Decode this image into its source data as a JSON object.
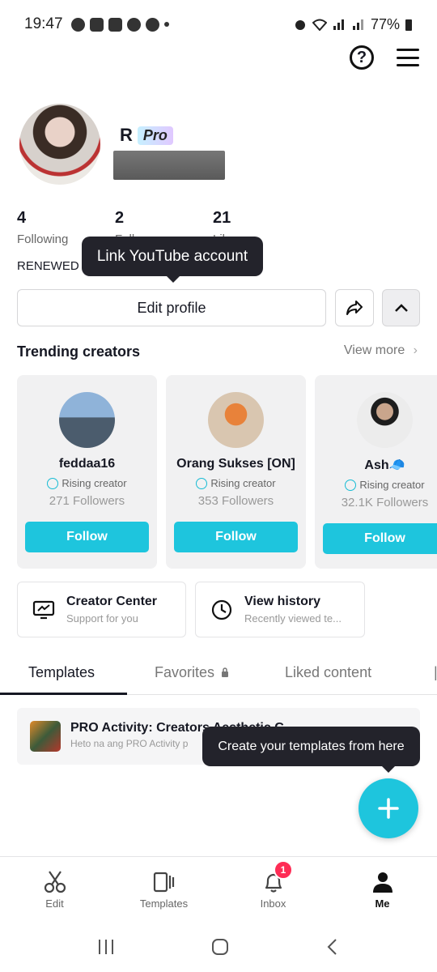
{
  "status_bar": {
    "time": "19:47",
    "battery": "77%"
  },
  "profile": {
    "name": "R",
    "pro_badge": "Pro",
    "stats": [
      {
        "value": "4",
        "label": "Following"
      },
      {
        "value": "2",
        "label": "Followers"
      },
      {
        "value": "21",
        "label": "Likes"
      }
    ],
    "bio": "RENEWED",
    "youtube_tooltip": "Link YouTube account",
    "edit_profile": "Edit profile"
  },
  "trending": {
    "title": "Trending creators",
    "view_more": "View more",
    "creators": [
      {
        "name": "feddaa16",
        "tag": "Rising creator",
        "followers": "271 Followers",
        "follow": "Follow"
      },
      {
        "name": "Orang Sukses [ON]",
        "tag": "Rising creator",
        "followers": "353 Followers",
        "follow": "Follow"
      },
      {
        "name": "Ash🧢",
        "tag": "Rising creator",
        "followers": "32.1K Followers",
        "follow": "Follow"
      }
    ]
  },
  "tiles": [
    {
      "title": "Creator Center",
      "subtitle": "Support for you",
      "icon": "chart-monitor-icon"
    },
    {
      "title": "View history",
      "subtitle": "Recently viewed te...",
      "icon": "clock-icon"
    }
  ],
  "tabs": [
    "Templates",
    "Favorites",
    "Liked content"
  ],
  "template_item": {
    "title": "PRO Activity: Creators Aesthetic C",
    "subtitle": "Heto na ang PRO Activity p"
  },
  "template_tooltip": "Create your templates from here",
  "bottom_nav": [
    {
      "label": "Edit",
      "icon": "scissors-icon"
    },
    {
      "label": "Templates",
      "icon": "templates-icon"
    },
    {
      "label": "Inbox",
      "icon": "bell-icon",
      "badge": "1"
    },
    {
      "label": "Me",
      "icon": "person-icon"
    }
  ],
  "colors": {
    "accent": "#1ec5dd",
    "badge": "#fe2c55",
    "tooltip": "#23232b"
  }
}
